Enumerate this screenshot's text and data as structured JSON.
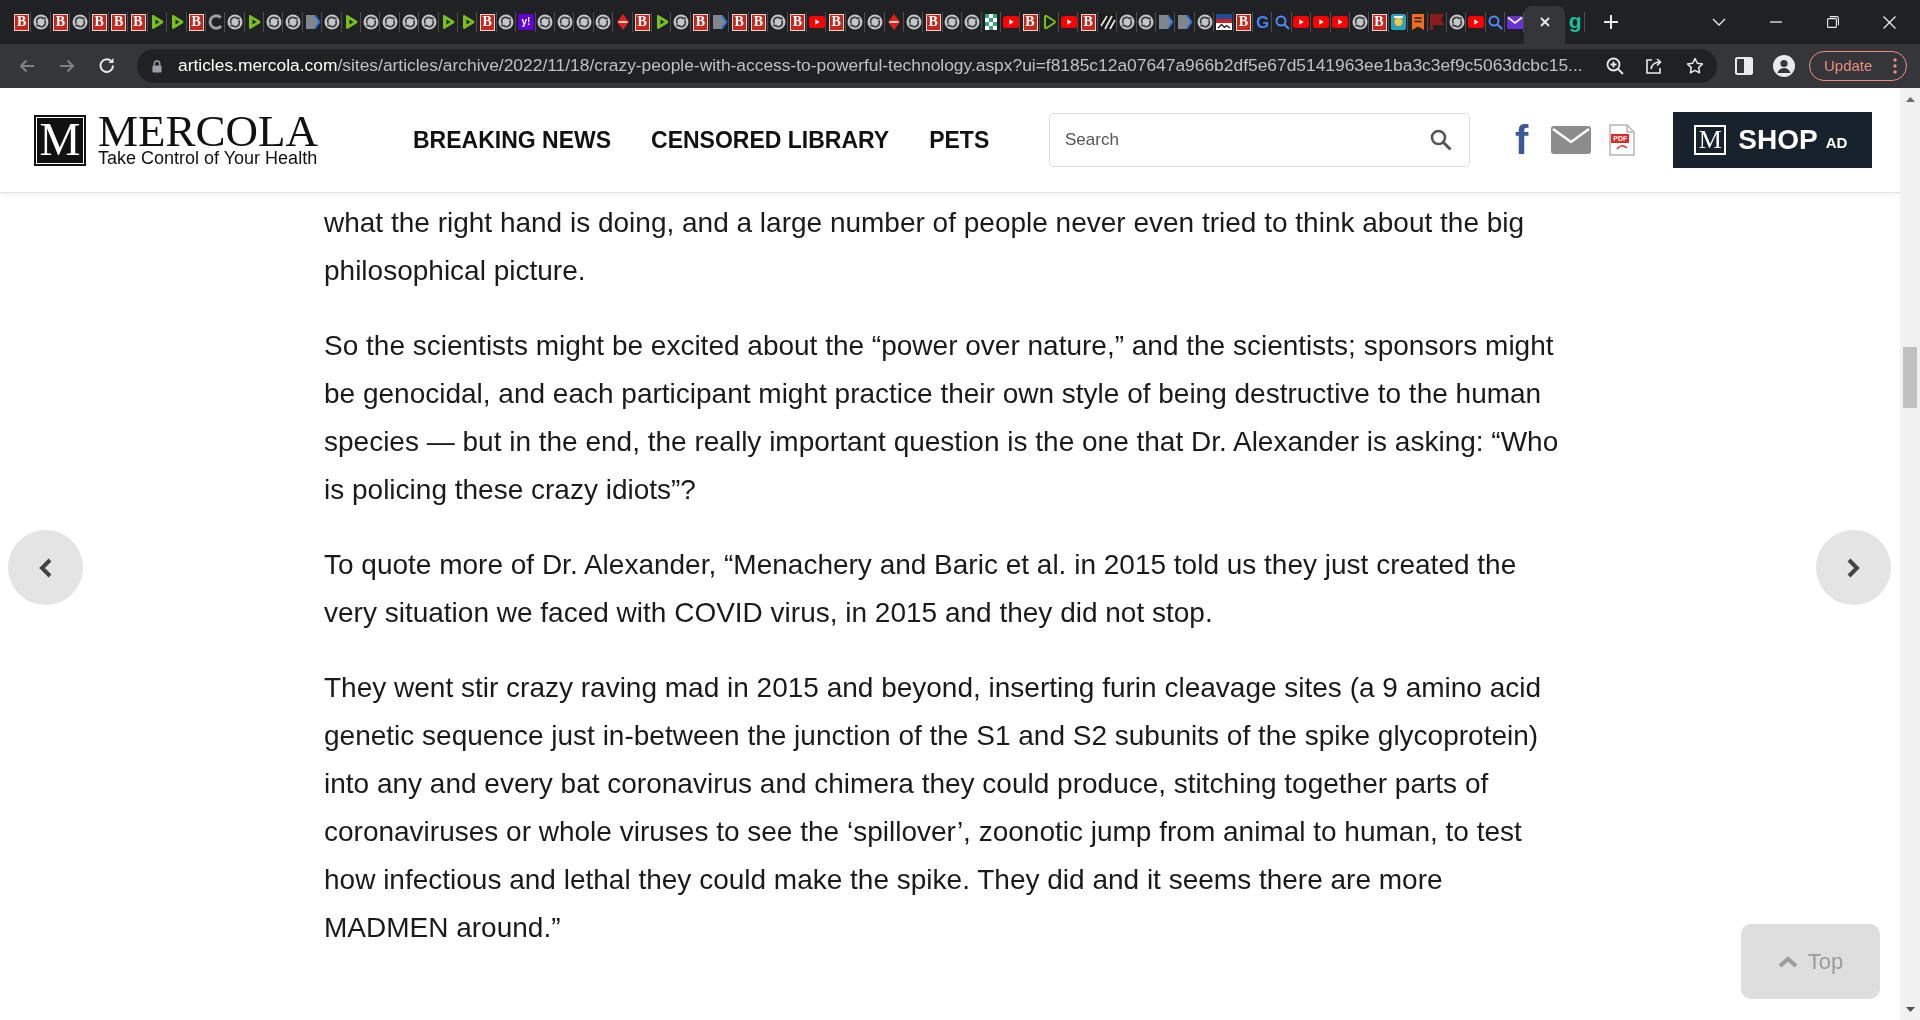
{
  "browser": {
    "tabs": [
      {
        "kind": "red-letter",
        "glyph": "B",
        "selected": false
      },
      {
        "kind": "sync",
        "selected": false
      },
      {
        "kind": "red-letter",
        "glyph": "B",
        "selected": false
      },
      {
        "kind": "sync",
        "selected": false
      },
      {
        "kind": "red-letter",
        "glyph": "B",
        "selected": false
      },
      {
        "kind": "red-letter",
        "glyph": "B",
        "selected": false
      },
      {
        "kind": "red-letter",
        "glyph": "B",
        "selected": false
      },
      {
        "kind": "play",
        "selected": false
      },
      {
        "kind": "play",
        "selected": false
      },
      {
        "kind": "red-letter",
        "glyph": "B",
        "selected": false
      },
      {
        "kind": "ring",
        "selected": false
      },
      {
        "kind": "sync",
        "selected": false
      },
      {
        "kind": "play",
        "selected": false
      },
      {
        "kind": "sync",
        "selected": false
      },
      {
        "kind": "sync",
        "selected": false
      },
      {
        "kind": "tag",
        "selected": false
      },
      {
        "kind": "sync",
        "selected": false
      },
      {
        "kind": "play",
        "selected": false
      },
      {
        "kind": "sync",
        "selected": false
      },
      {
        "kind": "sync",
        "selected": false
      },
      {
        "kind": "sync",
        "selected": false
      },
      {
        "kind": "sync",
        "selected": false
      },
      {
        "kind": "play",
        "selected": false
      },
      {
        "kind": "play",
        "selected": false
      },
      {
        "kind": "red-letter",
        "glyph": "B",
        "selected": false
      },
      {
        "kind": "sync",
        "selected": false
      },
      {
        "kind": "purple-letter",
        "glyph": "y!",
        "selected": false
      },
      {
        "kind": "sync",
        "selected": false
      },
      {
        "kind": "sync",
        "selected": false
      },
      {
        "kind": "sync",
        "selected": false
      },
      {
        "kind": "sync",
        "selected": false
      },
      {
        "kind": "diamond",
        "selected": false
      },
      {
        "kind": "red-letter",
        "glyph": "B",
        "selected": false
      },
      {
        "kind": "play",
        "selected": false
      },
      {
        "kind": "sync",
        "selected": false
      },
      {
        "kind": "red-letter",
        "glyph": "B",
        "selected": false
      },
      {
        "kind": "tag",
        "selected": false
      },
      {
        "kind": "red-letter",
        "glyph": "B",
        "selected": false
      },
      {
        "kind": "red-letter",
        "glyph": "B",
        "selected": false
      },
      {
        "kind": "sync",
        "selected": false
      },
      {
        "kind": "red-letter",
        "glyph": "B",
        "selected": false
      },
      {
        "kind": "video",
        "selected": false
      },
      {
        "kind": "red-letter",
        "glyph": "B",
        "selected": false
      },
      {
        "kind": "sync",
        "selected": false
      },
      {
        "kind": "sync",
        "selected": false
      },
      {
        "kind": "diamond",
        "selected": false
      },
      {
        "kind": "sync",
        "selected": false
      },
      {
        "kind": "red-letter",
        "glyph": "B",
        "selected": false
      },
      {
        "kind": "sync",
        "selected": false
      },
      {
        "kind": "sync",
        "selected": false
      },
      {
        "kind": "checker",
        "selected": false
      },
      {
        "kind": "video",
        "selected": false
      },
      {
        "kind": "red-letter",
        "glyph": "B",
        "selected": false
      },
      {
        "kind": "play-outline",
        "selected": false
      },
      {
        "kind": "video",
        "selected": false
      },
      {
        "kind": "red-letter",
        "glyph": "B",
        "selected": false
      },
      {
        "kind": "stripes",
        "selected": false
      },
      {
        "kind": "sync",
        "selected": false
      },
      {
        "kind": "sync",
        "selected": false
      },
      {
        "kind": "tag",
        "selected": false
      },
      {
        "kind": "tag",
        "selected": false
      },
      {
        "kind": "sync",
        "selected": false
      },
      {
        "kind": "picture",
        "selected": false
      },
      {
        "kind": "red-letter",
        "glyph": "B",
        "selected": false
      },
      {
        "kind": "blue-letter",
        "glyph": "G",
        "selected": false
      },
      {
        "kind": "magnifier",
        "selected": false
      },
      {
        "kind": "video",
        "selected": false
      },
      {
        "kind": "video",
        "selected": false
      },
      {
        "kind": "video",
        "selected": false
      },
      {
        "kind": "sync",
        "selected": false
      },
      {
        "kind": "red-letter",
        "glyph": "B",
        "selected": false
      },
      {
        "kind": "app",
        "selected": false
      },
      {
        "kind": "bookmark",
        "selected": false
      },
      {
        "kind": "flag",
        "selected": false
      },
      {
        "kind": "sync",
        "selected": false
      },
      {
        "kind": "video",
        "selected": false
      },
      {
        "kind": "magnifier",
        "selected": false
      },
      {
        "kind": "envelope",
        "selected": false
      },
      {
        "kind": "blank",
        "selected": true
      },
      {
        "kind": "green-letter",
        "glyph": "g",
        "selected": false
      }
    ]
  },
  "toolbar": {
    "nav_buttons": [
      {
        "kind": "back",
        "disabled": true
      },
      {
        "kind": "forward",
        "disabled": true
      },
      {
        "kind": "reload",
        "disabled": false
      }
    ],
    "url": {
      "host": "articles.mercola.com",
      "path": "/sites/articles/archive/2022/11/18/crazy-people-with-access-to-powerful-technology.aspx?ui=f8185c12a07647a966b2df5e67d5141963ee1ba3c3ef9c5063dcbc15..."
    },
    "update_button": "Update"
  },
  "header": {
    "logo": {
      "mark": "M",
      "name": "MERCOLA",
      "tagline": "Take Control of Your Health"
    },
    "nav": [
      "BREAKING NEWS",
      "CENSORED LIBRARY",
      "PETS"
    ],
    "search": {
      "placeholder": "Search"
    },
    "social": [
      {
        "kind": "letter",
        "glyph": "f"
      },
      {
        "kind": "envelope"
      },
      {
        "kind": "document",
        "label": "PDF"
      }
    ],
    "shop_button": {
      "mark": "M",
      "label": "SHOP",
      "badge": "AD"
    }
  },
  "article": {
    "paragraphs": [
      {
        "lines": [
          "what the right hand is doing, and a large number of people never even tried to think about the big",
          "philosophical picture."
        ]
      },
      {
        "lines": [
          "So the scientists might be excited about the “power over nature,” and the scientists; sponsors might",
          "be genocidal, and each participant might practice their own style of being destructive to the human",
          "species — but in the end, the really important question is the one that Dr. Alexander is asking: “Who",
          "is policing these crazy idiots”?"
        ]
      },
      {
        "lines": [
          "To quote more of Dr. Alexander, “Menachery and Baric et al. in 2015 told us they just created the",
          "very situation we faced with COVID virus, in 2015 and they did not stop."
        ]
      },
      {
        "lines": [
          "They went stir crazy raving mad in 2015 and beyond, inserting furin cleavage sites (a 9 amino acid",
          "genetic sequence just in-between the junction of the S1 and S2 subunits of the spike glycoprotein)",
          "into any and every bat coronavirus and chimera they could produce, stitching together parts of",
          "coronaviruses or whole viruses to see the ‘spillover’, zoonotic jump from animal to human, to test",
          "how infectious and lethal they could make the spike. They did and it seems there are more",
          "MADMEN around.”"
        ]
      }
    ]
  },
  "back_to_top": {
    "label": "Top"
  }
}
